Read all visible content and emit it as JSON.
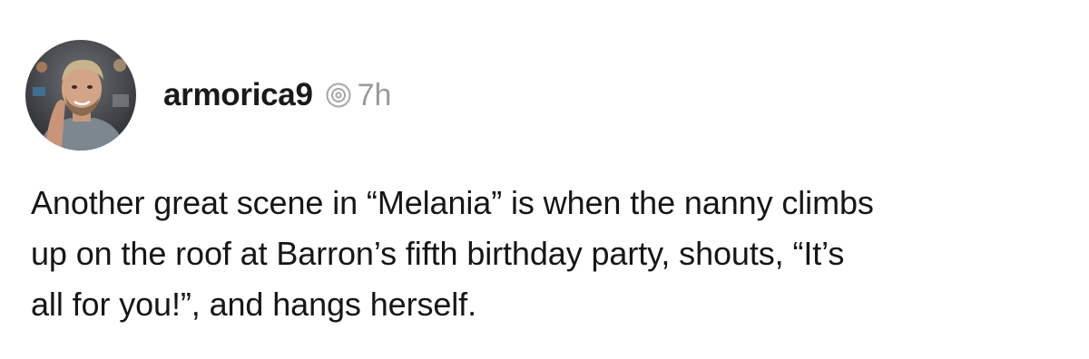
{
  "post": {
    "username": "armorica9",
    "time_ago": "7h",
    "avatar_icon": "user-avatar-photo",
    "threads_icon": "threads-icon",
    "text_lines": [
      "Another great scene in “Melania” is when the nanny climbs",
      "up on the roof at Barron’s fifth birthday party, shouts, “It’s",
      "all for you!”, and hangs herself."
    ]
  }
}
